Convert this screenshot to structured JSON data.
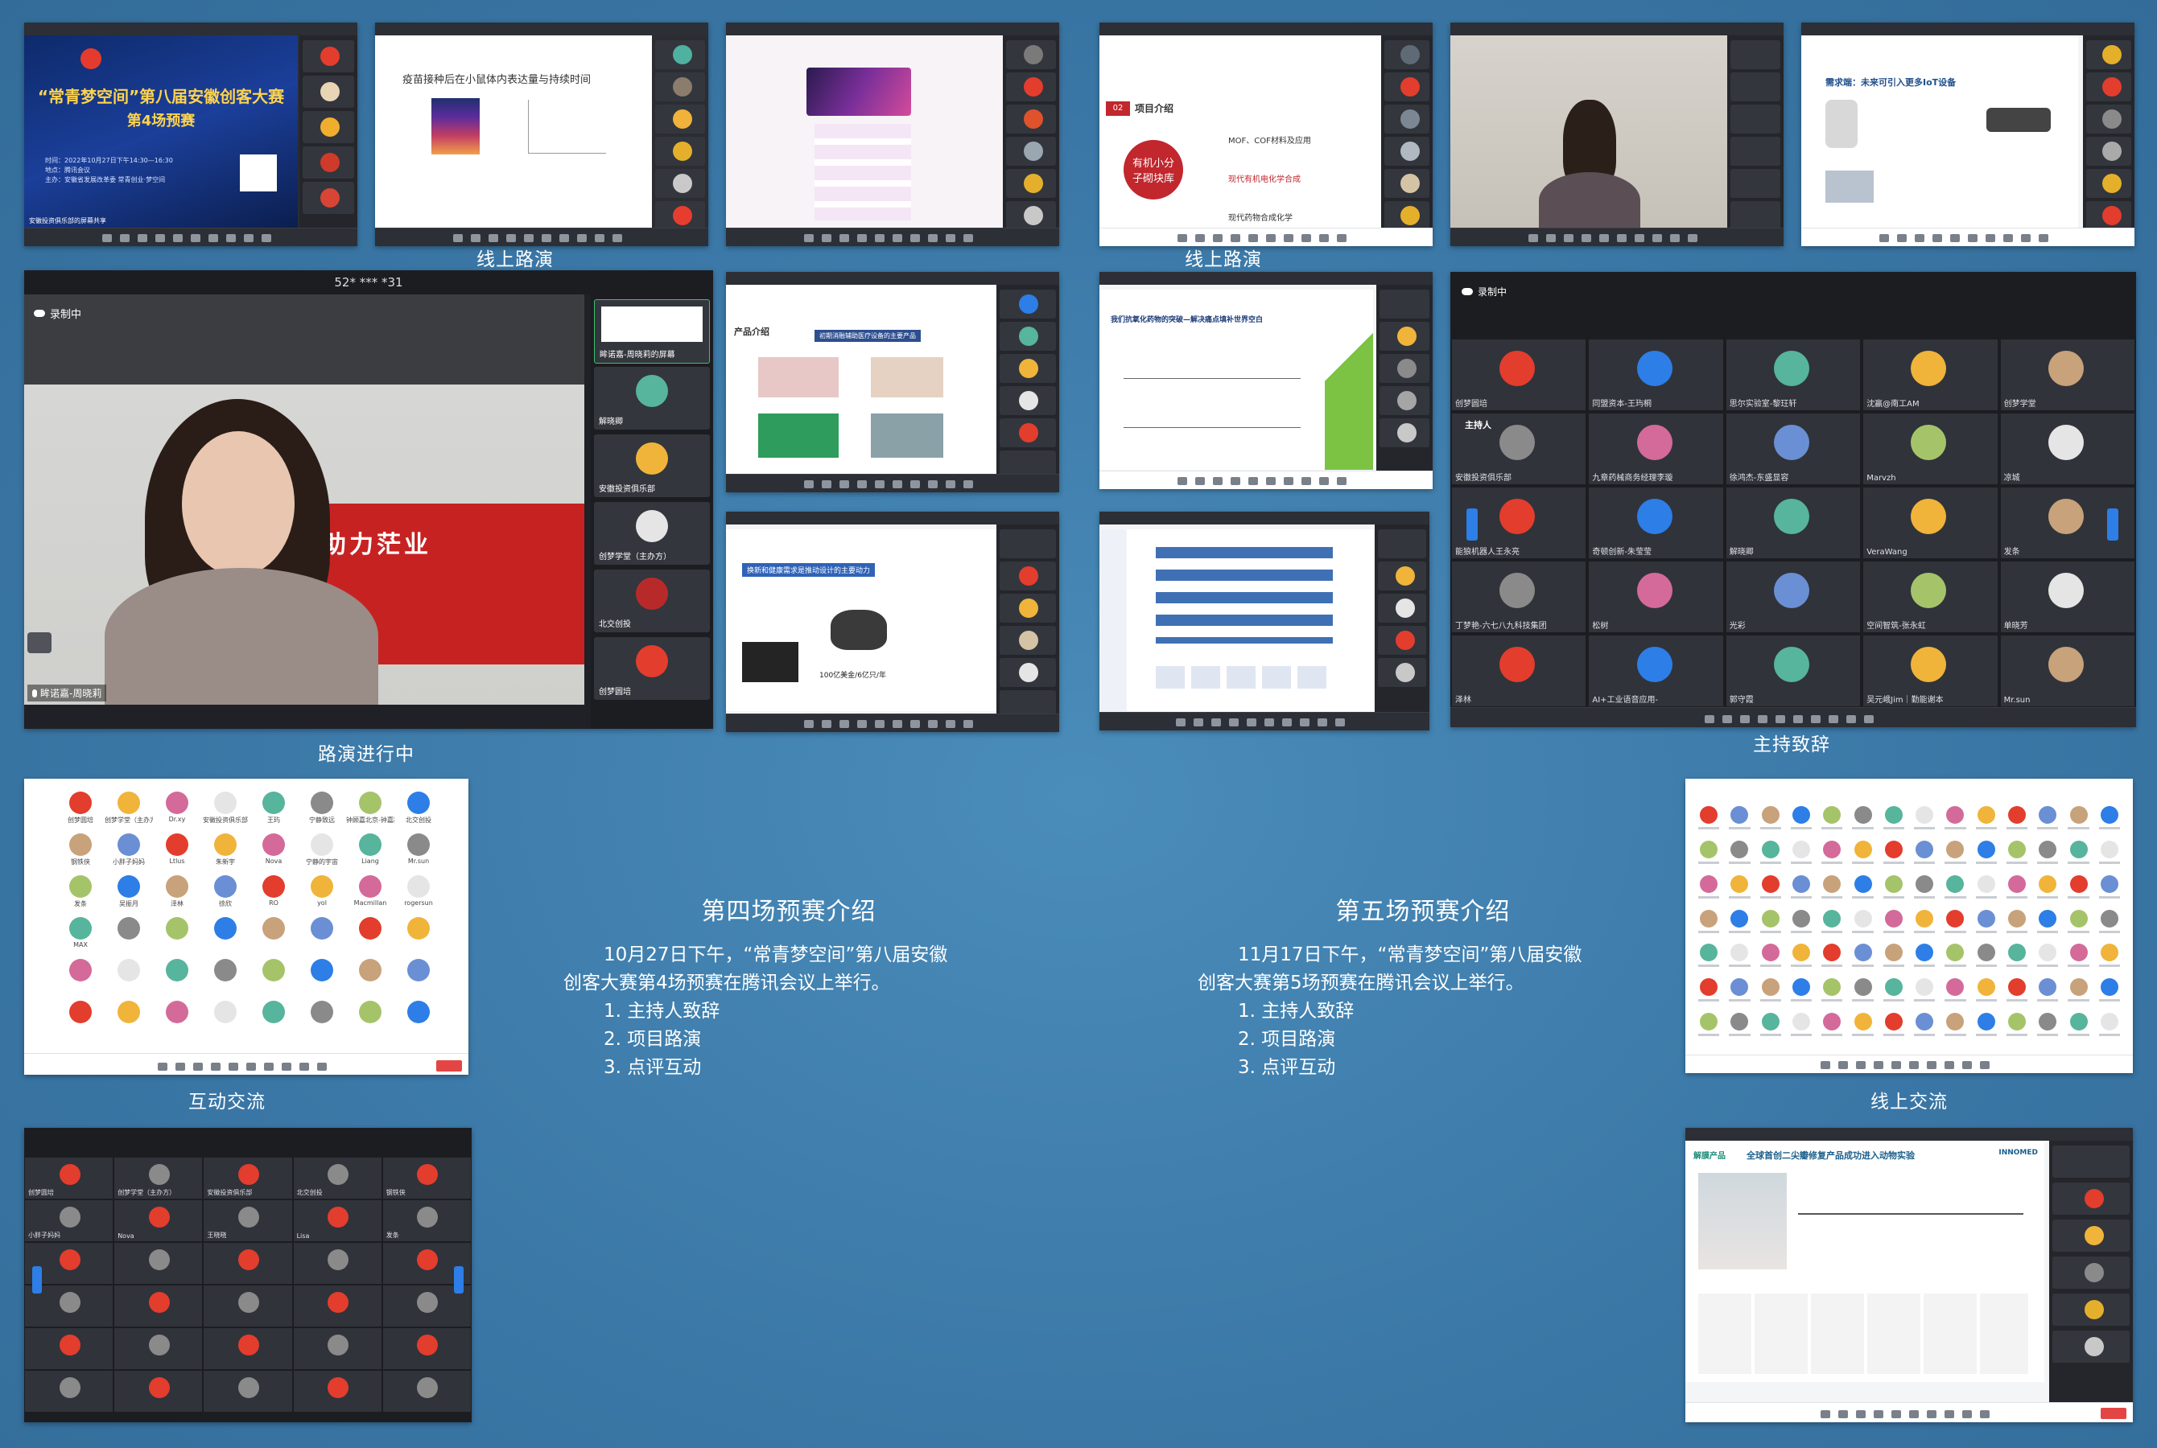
{
  "captions": {
    "row1_left": "线上路演",
    "row1_right": "线上路演",
    "big_video": "路演进行中",
    "gallery": "主持致辞",
    "interaction": "互动交流",
    "online": "线上交流"
  },
  "intro4": {
    "title": "第四场预赛介绍",
    "line1": "10月27日下午，“常青梦空间”第八届安徽",
    "line2": "创客大赛第4场预赛在腾讯会议上举行。",
    "items": [
      "1. 主持人致辞",
      "2. 项目路演",
      "3. 点评互动"
    ]
  },
  "intro5": {
    "title": "第五场预赛介绍",
    "line1": "11月17日下午，“常青梦空间”第八届安徽",
    "line2": "创客大赛第5场预赛在腾讯会议上举行。",
    "items": [
      "1. 主持人致辞",
      "2. 项目路演",
      "3. 点评互动"
    ]
  },
  "shot1": {
    "title_a": "“常青梦空间”第八届安徽创客大赛",
    "title_b": "第4场预赛",
    "date": "时间：2022年10月27日下午14:30—16:30",
    "place": "地点：腾讯会议",
    "org": "主办：安徽省发展改革委 常青创业·梦空间",
    "footer": "安徽投资俱乐部的屏幕共享"
  },
  "shot2": {
    "title": "疫苗接种后在小鼠体内表达量与持续时间"
  },
  "shot4": {
    "badge": "02",
    "heading": "项目介绍",
    "circle": "有机小分子砌块库",
    "items": [
      "MOF、COF材料及应用",
      "现代有机电化学合成",
      "现代药物合成化学"
    ]
  },
  "shot6": {
    "heading": "需求端：未来可引入更多IoT设备"
  },
  "bigvideo": {
    "header": "52* *** *31",
    "rec": "录制中",
    "speaker": "眸诺嘉-周晓莉",
    "banner": "助力茫业",
    "side": [
      "眸诺嘉-周晓莉的屏幕",
      "解晓卿",
      "安徽投资俱乐部",
      "创梦学堂（主办方）",
      "北交创投",
      "创梦圆培"
    ]
  },
  "shot8": {
    "heading": "产品介绍",
    "banner": "初期消融辅助医疗设备的主要产品"
  },
  "shot9": {
    "heading": "我们抗氧化药物的突破—解决痛点填补世界空白"
  },
  "shot10": {
    "heading": "换新和健康需求是推动设计的主要动力",
    "stat": "100亿美金/6亿只/年"
  },
  "gallery": {
    "rec": "录制中",
    "host_label": "主持人",
    "names": [
      "创梦圆培",
      "同盟资本-王玙桐",
      "思尔实验室-黎玨轩",
      "沈赢@南工AM",
      "创梦学堂",
      "安徽投资俱乐部",
      "九章药械商务经理李璇",
      "徐鸿杰-东盛显容",
      "Marvzh",
      "凉城",
      "能狼机器人王永亮",
      "奇顿创新-朱莹莹",
      "解晓卿",
      "VeraWang",
      "发条",
      "丁梦艳-六七八九科技集团",
      "松树",
      "光彩",
      "空间智筑-张永虹",
      "单晓芳",
      "泽林",
      "AI+工业语音应用-",
      "郭守霞",
      "吴元峨Jim｜勤能谢本",
      "Mr.sun"
    ]
  },
  "interact": {
    "names": [
      "创梦圆培",
      "创梦学堂（主办方）",
      "Dr.xy",
      "安徽投资俱乐部",
      "王玙",
      "宁静致远",
      "钟顾嘉北京-钟嘉路",
      "北交创投",
      "钢铁侠",
      "小胖子妈妈",
      "Ltlus",
      "朱新宇",
      "Nova",
      "宁静的宇宙",
      "Liang",
      "Mr.sun",
      "发条",
      "吴振月",
      "泽林",
      "徐欣",
      "RO",
      "yol",
      "Macmillan",
      "rogersun",
      "MAX"
    ]
  },
  "shot14": {
    "heading": "全球首创二尖瓣修复产品成功进入动物实验",
    "tag": "解膜产品",
    "logo": "INNOMED"
  },
  "shot13": {
    "names": [
      "创梦圆培",
      "创梦学堂（主办方）",
      "安徽投资俱乐部",
      "北交创投",
      "钢铁侠",
      "小胖子妈妈",
      "Nova",
      "王晓晓",
      "Lisa",
      "发条"
    ]
  }
}
